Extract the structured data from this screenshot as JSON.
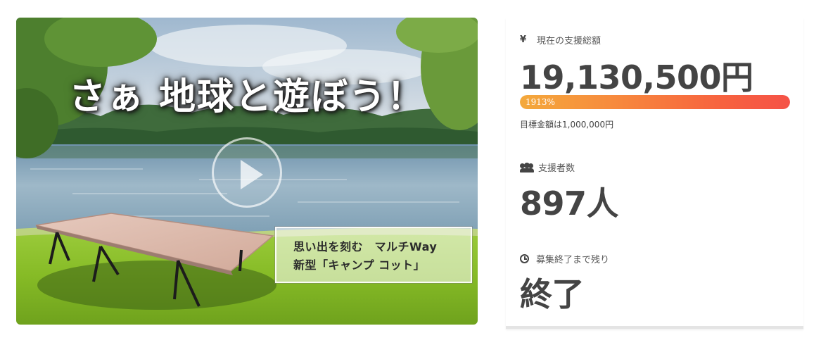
{
  "hero": {
    "headline": "さぁ 地球と遊ぼう！",
    "caption_line1": "思い出を刻む　マルチWay",
    "caption_line2": "新型「キャンプ コット」"
  },
  "stats": {
    "total": {
      "icon": "yen-icon",
      "icon_glyph": "¥",
      "label": "現在の支援総額",
      "value": "19,130,500円",
      "progress_text": "1913%",
      "progress_fraction": 1.0,
      "goal_text": "目標金額は1,000,000円"
    },
    "supporters": {
      "icon": "users-icon",
      "label": "支援者数",
      "value": "897人"
    },
    "remaining": {
      "icon": "clock-icon",
      "label": "募集終了まで残り",
      "value": "終了"
    }
  },
  "colors": {
    "progress_start": "#f4a93c",
    "progress_end": "#f55247",
    "text_dark": "#444444"
  }
}
